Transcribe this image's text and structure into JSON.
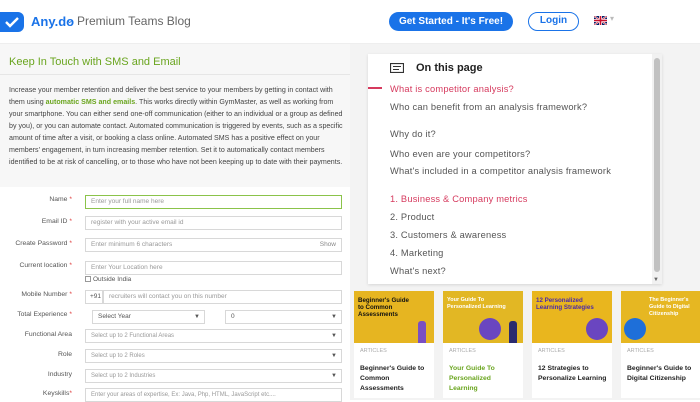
{
  "header": {
    "brand": "Any.do",
    "brand_chevron": "⌄",
    "blog_title": "Premium Teams Blog",
    "cta_label": "Get Started - It's Free!",
    "login_label": "Login",
    "language_icon": "uk-flag-icon",
    "accent_color": "#1a73e8"
  },
  "left": {
    "section_title": "Keep In Touch with SMS and Email",
    "paragraph_pre": "Increase your member retention and deliver the best service to your members by getting in contact with them using ",
    "paragraph_highlight": "automatic SMS and emails",
    "paragraph_post": ". This works directly within GymMaster, as well as working from your smartphone. You can either send one-off communication (either to an individual or a group as defined by you), or you can automate contact. Automated communication is triggered by events, such as a specific amount of time after a visit, or booking a class online. Automated SMS has a positive effect on your members' engagement, in turn increasing member retention. Set it to automatically contact members identified to be at risk of cancelling, or to those who have not been keeping up to date with their payments.",
    "highlight_color": "#6aa51f"
  },
  "form": {
    "name_label": "Name",
    "name_placeholder": "Enter your full name here",
    "email_label": "Email ID",
    "email_placeholder": "register with your active email id",
    "password_label": "Create Password",
    "password_placeholder": "Enter minimum 6 characters",
    "password_show": "Show",
    "location_label": "Current location",
    "location_placeholder": "Enter Your Location here",
    "outside_india": "Outside India",
    "mobile_label": "Mobile Number",
    "mobile_code": "+91",
    "mobile_placeholder": "recruiters will contact you on this number",
    "experience_label": "Total Experience",
    "experience_year": "Select Year",
    "experience_month": "0",
    "functional_label": "Functional Area",
    "functional_placeholder": "Select up to 2 Functional Areas",
    "role_label": "Role",
    "role_placeholder": "Select up to 2 Roles",
    "industry_label": "Industry",
    "industry_placeholder": "Select up to 2 Industries",
    "keyskills_label": "Keyskills",
    "keyskills_placeholder": "Enter your areas of expertise, Ex: Java, Php, HTML, JavaScript etc....",
    "required_mark": "*"
  },
  "toc": {
    "heading": "On this page",
    "items": [
      "What is competitor analysis?",
      "Who can benefit from an analysis framework?",
      "Why do it?",
      "Who even are your competitors?",
      "What's included in a competitor analysis framework",
      "1. Business & Company metrics",
      "2. Product",
      "3. Customers & awareness",
      "4. Marketing",
      "What's next?"
    ],
    "active_color": "#d63a5e"
  },
  "cards": [
    {
      "image_title": "Beginner's Guide to Common Assessments",
      "category": "ARTICLES",
      "title": "Beginner's Guide to Common Assessments"
    },
    {
      "image_title": "Your Guide To Personalized Learning",
      "category": "ARTICLES",
      "title": "Your Guide To Personalized Learning"
    },
    {
      "image_title": "12 Personalized Learning Strategies",
      "category": "ARTICLES",
      "title": "12 Strategies to Personalize Learning"
    },
    {
      "image_title": "The Beginner's Guide to Digital Citizenship",
      "category": "ARTICLES",
      "title": "Beginner's Guide to Digital Citizenship"
    }
  ]
}
